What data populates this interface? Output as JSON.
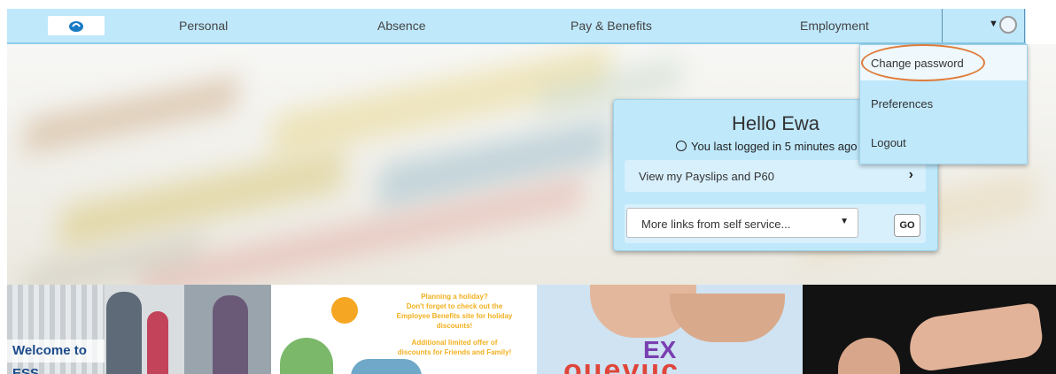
{
  "nav": {
    "items": [
      "Personal",
      "Absence",
      "Pay & Benefits",
      "Employment"
    ]
  },
  "user_menu": {
    "items": [
      "Change password",
      "Preferences",
      "Logout"
    ]
  },
  "card": {
    "greeting": "Hello Ewa",
    "last_login": "You last logged in 5 minutes ago",
    "payslips_link": "View my Payslips and P60",
    "links_select_value": "More links from self service...",
    "go_label": "GO"
  },
  "banners": {
    "welcome_label": "Welcome to ESS",
    "promo_lines": [
      "Planning a holiday?",
      "Don't forget to check out the",
      "Employee Benefits site for holiday",
      "discounts!",
      "Additional limited offer of",
      "discounts for Friends and Family!"
    ],
    "letters_text": "EX",
    "letters_row_text": "ouevuc"
  },
  "colors": {
    "nav_bg": "#bfe8fb",
    "highlight": "#e07b39"
  }
}
